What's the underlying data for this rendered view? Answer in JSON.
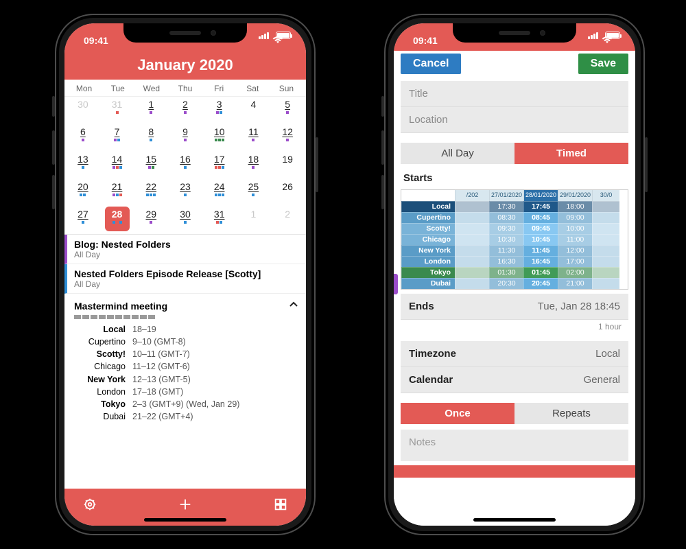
{
  "status": {
    "time": "09:41"
  },
  "left": {
    "header_title": "January 2020",
    "weekdays": [
      "Mon",
      "Tue",
      "Wed",
      "Thu",
      "Fri",
      "Sat",
      "Sun"
    ],
    "days": [
      {
        "n": 30,
        "faded": true
      },
      {
        "n": 31,
        "faded": true,
        "dots": [
          "#e35a55"
        ]
      },
      {
        "n": 1,
        "dots": [
          "#9b4dca"
        ]
      },
      {
        "n": 2,
        "dots": [
          "#9b4dca"
        ]
      },
      {
        "n": 3,
        "dots": [
          "#9b4dca",
          "#2f8fd8"
        ]
      },
      {
        "n": 4
      },
      {
        "n": 5,
        "dots": [
          "#9b4dca"
        ]
      },
      {
        "n": 6,
        "dots": [
          "#9b4dca"
        ]
      },
      {
        "n": 7,
        "dots": [
          "#9b4dca",
          "#2f8fd8"
        ]
      },
      {
        "n": 8,
        "dots": [
          "#2f8fd8"
        ]
      },
      {
        "n": 9,
        "dots": [
          "#9b4dca"
        ]
      },
      {
        "n": 10,
        "dots": [
          "#3a8a4e",
          "#3a8a4e",
          "#3a8a4e"
        ]
      },
      {
        "n": 11,
        "dots": [
          "#9b4dca"
        ]
      },
      {
        "n": 12,
        "dots": [
          "#9b4dca"
        ]
      },
      {
        "n": 13,
        "dots": [
          "#2f8fd8"
        ]
      },
      {
        "n": 14,
        "dots": [
          "#9b4dca",
          "#e35a55",
          "#2f8fd8"
        ]
      },
      {
        "n": 15,
        "dots": [
          "#9b4dca",
          "#3a8a4e"
        ]
      },
      {
        "n": 16,
        "dots": [
          "#2f8fd8"
        ]
      },
      {
        "n": 17,
        "dots": [
          "#e35a55",
          "#e35a55",
          "#2f8fd8"
        ]
      },
      {
        "n": 18,
        "dots": [
          "#9b4dca"
        ]
      },
      {
        "n": 19
      },
      {
        "n": 20,
        "dots": [
          "#2f8fd8",
          "#2f8fd8"
        ]
      },
      {
        "n": 21,
        "dots": [
          "#9b4dca",
          "#2f8fd8",
          "#e35a55"
        ]
      },
      {
        "n": 22,
        "dots": [
          "#2f8fd8",
          "#2f8fd8",
          "#2f8fd8"
        ]
      },
      {
        "n": 23,
        "dots": [
          "#2f8fd8"
        ]
      },
      {
        "n": 24,
        "dots": [
          "#2f8fd8",
          "#2f8fd8",
          "#2f8fd8"
        ]
      },
      {
        "n": 25,
        "dots": [
          "#2f8fd8"
        ]
      },
      {
        "n": 26
      },
      {
        "n": 27,
        "dots": [
          "#2f8fd8"
        ]
      },
      {
        "n": 28,
        "selected": true,
        "dots": [
          "#2f8fd8",
          "#e35a55",
          "#2f8fd8"
        ]
      },
      {
        "n": 29,
        "dots": [
          "#9b4dca"
        ]
      },
      {
        "n": 30,
        "dots": [
          "#2f8fd8"
        ]
      },
      {
        "n": 31,
        "dots": [
          "#e35a55",
          "#2f8fd8"
        ]
      },
      {
        "n": 1,
        "faded": true
      },
      {
        "n": 2,
        "faded": true
      }
    ],
    "events": [
      {
        "color": "purple",
        "title": "Blog: Nested Folders",
        "sub": "All Day"
      },
      {
        "color": "blue",
        "title": "Nested Folders Episode Release [Scotty]",
        "sub": "All Day"
      }
    ],
    "mastermind": {
      "title": "Mastermind meeting",
      "rows": [
        {
          "name": "Local",
          "time": "18–19",
          "bold": true
        },
        {
          "name": "Cupertino",
          "time": "9–10 (GMT-8)"
        },
        {
          "name": "Scotty!",
          "time": "10–11 (GMT-7)",
          "bold": true
        },
        {
          "name": "Chicago",
          "time": "11–12 (GMT-6)"
        },
        {
          "name": "New York",
          "time": "12–13 (GMT-5)",
          "bold": true
        },
        {
          "name": "London",
          "time": "17–18 (GMT)"
        },
        {
          "name": "Tokyo",
          "time": "2–3 (GMT+9) (Wed, Jan 29)",
          "bold": true
        },
        {
          "name": "Dubai",
          "time": "21–22 (GMT+4)"
        }
      ]
    }
  },
  "right": {
    "cancel": "Cancel",
    "save": "Save",
    "title_placeholder": "Title",
    "location_placeholder": "Location",
    "seg_allday": "All Day",
    "seg_timed": "Timed",
    "starts_label": "Starts",
    "picker_headers": [
      "",
      "/202",
      "27/01/2020",
      "28/01/2020",
      "29/01/2020",
      "30/0"
    ],
    "picker_rows": [
      {
        "style": "row-blue-dark",
        "name": "Local",
        "cells": [
          "",
          "17:30",
          "17:45",
          "18:00",
          ""
        ]
      },
      {
        "style": "row-blue-mid",
        "name": "Cupertino",
        "cells": [
          "",
          "08:30",
          "08:45",
          "09:00",
          ""
        ]
      },
      {
        "style": "row-blue-light",
        "name": "Scotty!",
        "cells": [
          "",
          "09:30",
          "09:45",
          "10:00",
          ""
        ]
      },
      {
        "style": "row-blue-light",
        "name": "Chicago",
        "cells": [
          "",
          "10:30",
          "10:45",
          "11:00",
          ""
        ]
      },
      {
        "style": "row-blue-mid",
        "name": "New York",
        "cells": [
          "",
          "11:30",
          "11:45",
          "12:00",
          ""
        ]
      },
      {
        "style": "row-blue-mid",
        "name": "London",
        "cells": [
          "",
          "16:30",
          "16:45",
          "17:00",
          ""
        ]
      },
      {
        "style": "row-green",
        "name": "Tokyo",
        "cells": [
          "",
          "01:30",
          "01:45",
          "02:00",
          ""
        ]
      },
      {
        "style": "row-blue-mid",
        "name": "Dubai",
        "cells": [
          "",
          "20:30",
          "20:45",
          "21:00",
          ""
        ]
      }
    ],
    "ends_label": "Ends",
    "ends_value": "Tue, Jan 28 18:45",
    "duration_note": "1 hour",
    "timezone_label": "Timezone",
    "timezone_value": "Local",
    "calendar_label": "Calendar",
    "calendar_value": "General",
    "seg_once": "Once",
    "seg_repeats": "Repeats",
    "notes_placeholder": "Notes"
  }
}
